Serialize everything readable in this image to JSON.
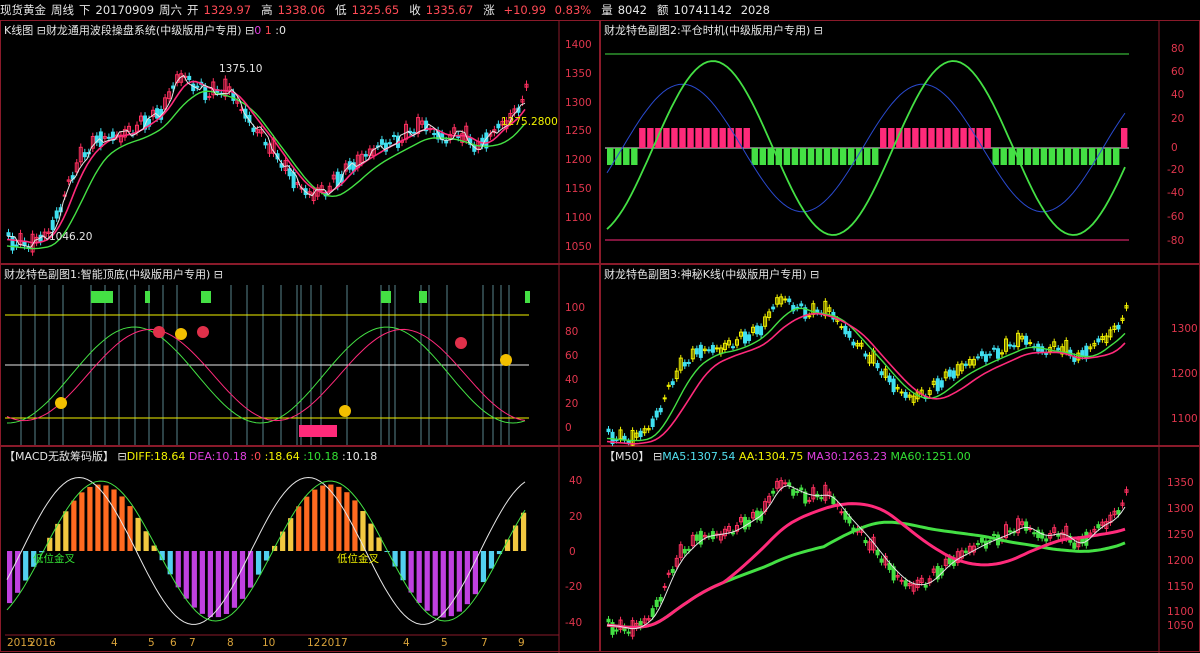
{
  "header": {
    "instrument": "现货黄金",
    "period": "周线",
    "position": "下",
    "date": "20170909",
    "weekday": "周六",
    "open_label": "开",
    "open": "1329.97",
    "high_label": "高",
    "high": "1338.06",
    "low_label": "低",
    "low": "1325.65",
    "close_label": "收",
    "close": "1335.67",
    "change_label": "涨",
    "change": "+10.99",
    "change_pct": "0.83%",
    "volume_label": "量",
    "volume": "8042",
    "amount_label": "额",
    "amount": "10741142",
    "amount_extra": "2028"
  },
  "colors": {
    "border": "#8a1a2a",
    "up": "#ff3060",
    "down": "#40e0f0",
    "green": "#44e044",
    "magenta": "#ff2a7a",
    "yellow": "#f2f200",
    "white": "#e6e6e6",
    "axis": "#e0364d"
  },
  "panels": {
    "kline": {
      "title": "K线图",
      "indicator": "财龙通用波段操盘系统(中级版用户专用)",
      "params": [
        "0",
        "1",
        ":0"
      ],
      "annotations": {
        "high": "1375.10",
        "low": "1046.20",
        "last": "1275.2800"
      },
      "y_ticks": [
        "1400",
        "1350",
        "1300",
        "1250",
        "1200",
        "1150",
        "1100",
        "1050"
      ]
    },
    "sub2": {
      "title": "财龙特色副图2:平仓时机(中级版用户专用)",
      "y_ticks": [
        "80",
        "60",
        "40",
        "20",
        "0",
        "-20",
        "-40",
        "-60",
        "-80"
      ]
    },
    "sub1": {
      "title": "财龙特色副图1:智能顶底(中级版用户专用)",
      "y_ticks": [
        "100",
        "80",
        "60",
        "40",
        "20",
        "0"
      ]
    },
    "sub3": {
      "title": "财龙特色副图3:神秘K线(中级版用户专用)",
      "y_ticks": [
        "1300",
        "1200",
        "1100"
      ]
    },
    "macd": {
      "title": "【MACD无敌筹码版】",
      "diff_label": "DIFF:18.64",
      "dea_label": "DEA:10.18",
      "z1": ":0",
      "v1": ":18.64",
      "v2": ":10.18",
      "v3": ":10.18",
      "tag_low": "低位金叉",
      "tag_low2": "低位金叉",
      "y_ticks": [
        "40",
        "20",
        "0",
        "-20",
        "-40"
      ],
      "x_labels": [
        "2015",
        "2016",
        "4",
        "5",
        "7",
        "8",
        "10",
        "12",
        "2017",
        "4",
        "5",
        "7",
        "9"
      ],
      "x_labels_b": [
        "6"
      ]
    },
    "m50": {
      "title": "【M50】",
      "ma5": "MA5:1307.54",
      "aa": "AA:1304.75",
      "ma30": "MA30:1263.23",
      "ma60": "MA60:1251.00",
      "y_ticks": [
        "1350",
        "1300",
        "1250",
        "1200",
        "1150",
        "1100",
        "1050"
      ]
    }
  }
}
